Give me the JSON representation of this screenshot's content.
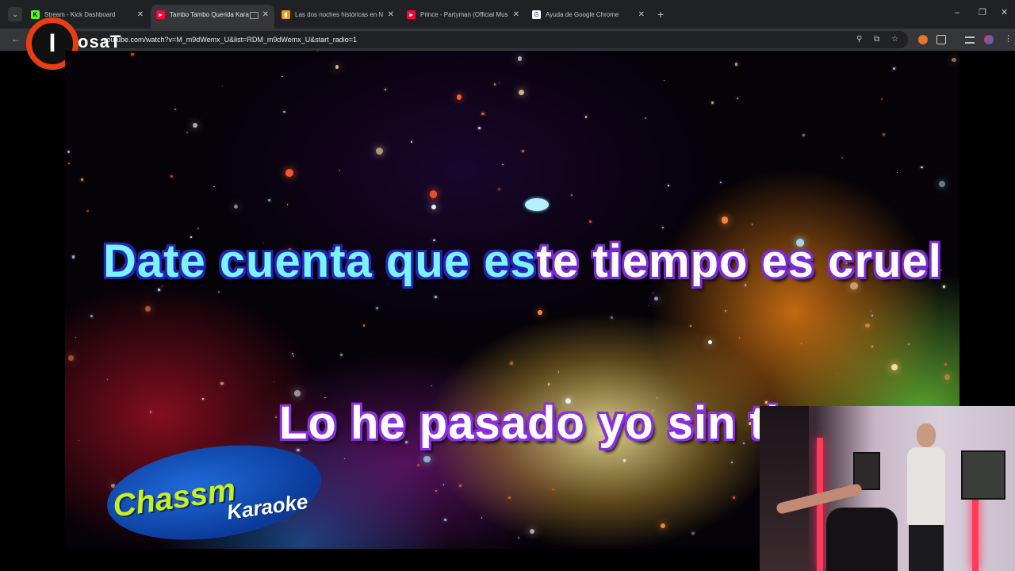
{
  "browser": {
    "tabs": [
      {
        "title": "Stream - Kick Dashboard",
        "favicon": "kick-icon",
        "color": "#53fc18",
        "active": false
      },
      {
        "title": "Tambo Tambo Querida Kara",
        "favicon": "youtube-icon",
        "color": "#ff0033",
        "active": true
      },
      {
        "title": "Las dos noches históricas en N",
        "favicon": "bookmark-icon",
        "color": "#f29900",
        "active": false
      },
      {
        "title": "Prince - Partyman (Official Mus",
        "favicon": "youtube-icon",
        "color": "#ff0033",
        "active": false
      },
      {
        "title": "Ayuda de Google Chrome",
        "favicon": "google-icon",
        "color": "#4285f4",
        "active": false
      }
    ],
    "new_tab_glyph": "+",
    "url": "youtube.com/watch?v=M_m9dWemx_U&list=RDM_m9dWemx_U&start_radio=1"
  },
  "overlay_logo": {
    "letter": "I",
    "text": "osaT"
  },
  "video": {
    "lyric_line1_sung": "Date cuenta que es",
    "lyric_line1_rest": "te tiempo es cruel",
    "lyric_line2": "Lo he pasado yo sin ti",
    "karaoke_brand": "Chassm",
    "karaoke_word": "Karaoke",
    "colors": {
      "sung": "#7af4ff",
      "unsung": "#ffffff",
      "accent_purple": "#8a2fe0"
    }
  }
}
